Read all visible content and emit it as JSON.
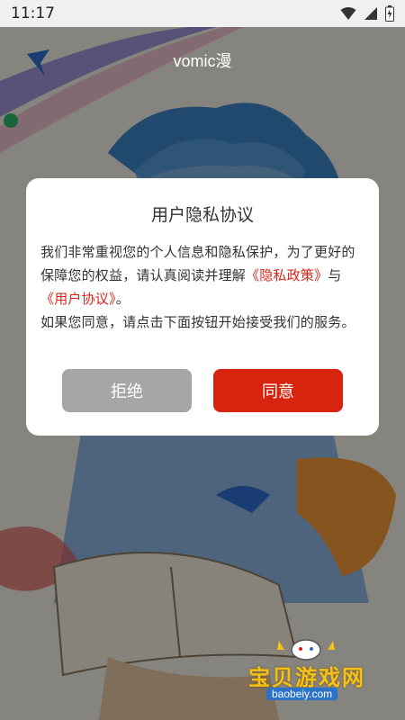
{
  "status_bar": {
    "time": "11:17",
    "icons": [
      "wifi-icon",
      "signal-icon",
      "battery-icon"
    ]
  },
  "app": {
    "title": "vomic漫"
  },
  "dialog": {
    "title": "用户隐私协议",
    "body_part1": "我们非常重视您的个人信息和隐私保护，为了更好的保障您的权益，请认真阅读并理解",
    "privacy_link": "《隐私政策》",
    "connector": "与",
    "agreement_link": "《用户协议》",
    "period": "。",
    "body_part2": "如果您同意，请点击下面按钮开始接受我们的服务。",
    "reject_label": "拒绝",
    "agree_label": "同意"
  },
  "watermark": {
    "text": "宝贝游戏网",
    "url": "baobeiy.com"
  },
  "colors": {
    "accent": "#d8230f",
    "reject_button": "#a6a6a6",
    "overlay": "rgba(0,0,0,0.45)"
  }
}
